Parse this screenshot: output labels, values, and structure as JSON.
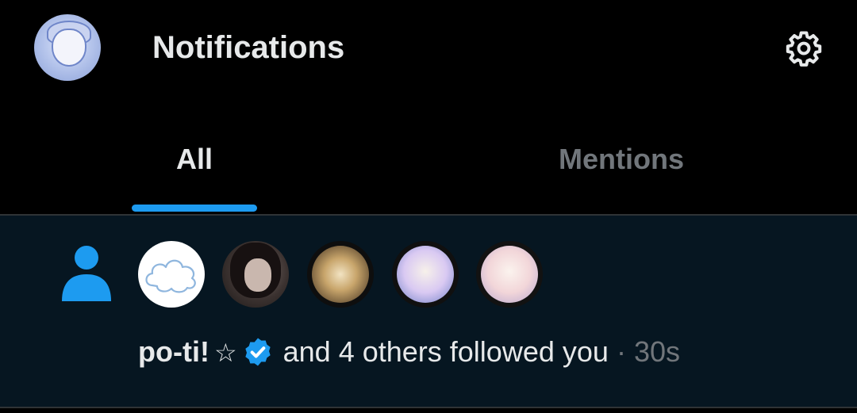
{
  "header": {
    "title": "Notifications",
    "settings_icon": "gear-icon"
  },
  "tabs": [
    {
      "label": "All",
      "active": true
    },
    {
      "label": "Mentions",
      "active": false
    }
  ],
  "notification": {
    "type_icon": "person-icon",
    "follower_count_avatars": 5,
    "name": "po-ti!",
    "name_suffix": "☆",
    "verified": true,
    "message": "and 4 others followed you",
    "separator": "·",
    "time": "30s"
  },
  "colors": {
    "background": "#000000",
    "accent": "#1d9bf0",
    "text_primary": "#e7e9ea",
    "text_secondary": "#71767b",
    "unread_background": "#061621",
    "divider": "#2f3336"
  }
}
